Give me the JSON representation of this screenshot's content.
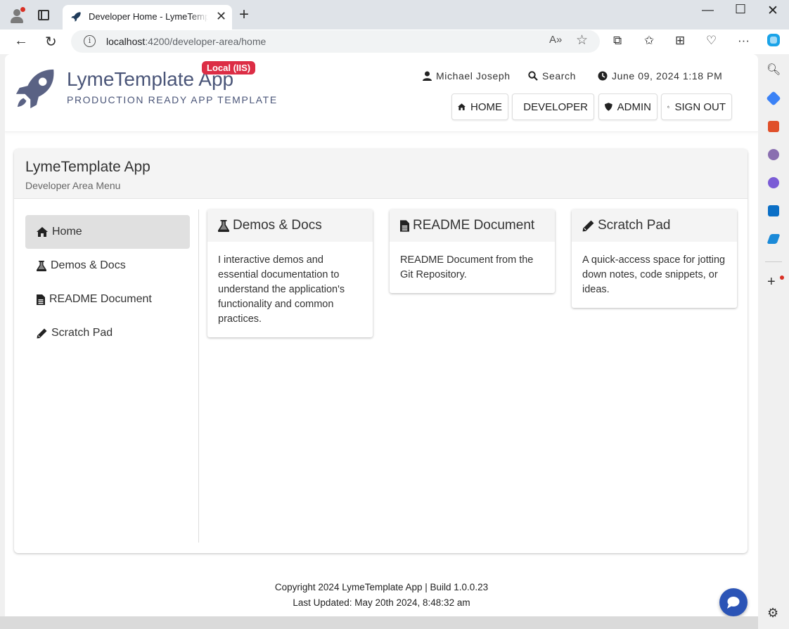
{
  "browser": {
    "tab_title": "Developer Home - LymeTemplate App",
    "url_host": "localhost",
    "url_rest": ":4200/developer-area/home"
  },
  "header": {
    "brand": "LymeTemplate App",
    "tagline": "PRODUCTION READY APP TEMPLATE",
    "env_badge": "Local (IIS)",
    "user": "Michael Joseph",
    "search": "Search",
    "datetime": "June 09, 2024 1:18 PM",
    "nav": [
      "HOME",
      "DEVELOPER",
      "ADMIN",
      "SIGN OUT"
    ]
  },
  "card": {
    "title": "LymeTemplate App",
    "subtitle": "Developer Area Menu"
  },
  "menu": [
    "Home",
    "Demos & Docs",
    "README Document",
    "Scratch Pad"
  ],
  "tiles": [
    {
      "title": "Demos & Docs",
      "body": "I interactive demos and essential documentation to understand the application's functionality and common practices."
    },
    {
      "title": "README Document",
      "body": "README Document from the Git Repository."
    },
    {
      "title": "Scratch Pad",
      "body": "A quick-access space for jotting down notes, code snippets, or ideas."
    }
  ],
  "footer": {
    "line1": "Copyright 2024 LymeTemplate App | Build 1.0.0.23",
    "line2": "Last Updated: May 20th 2024, 8:48:32 am"
  },
  "colors": {
    "brand": "#4a5578",
    "badge": "#dc2d45",
    "chat": "#2b54b6"
  }
}
